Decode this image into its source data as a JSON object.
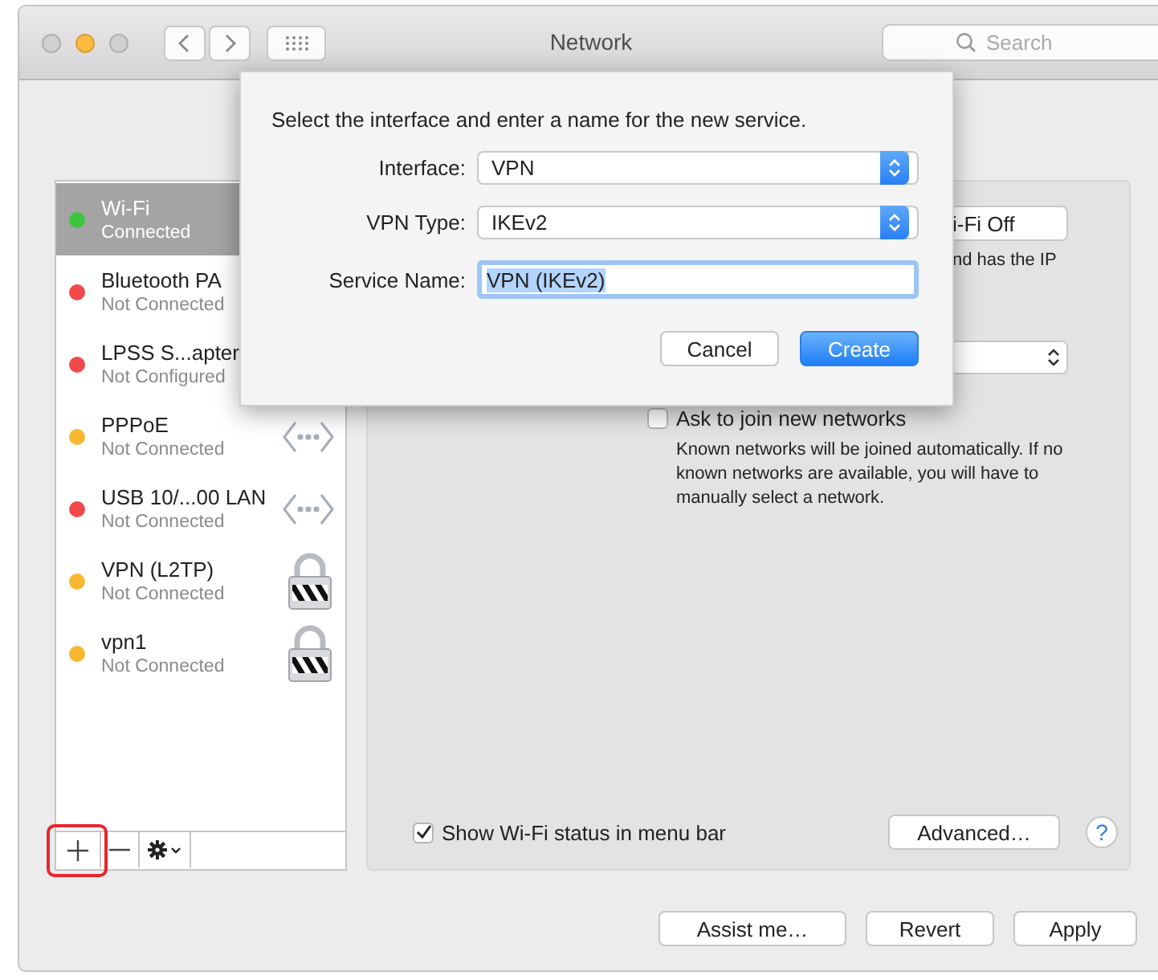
{
  "window": {
    "title": "Network",
    "lights": [
      {
        "kind": "close",
        "disabled": true
      },
      {
        "kind": "minimize",
        "disabled": false
      },
      {
        "kind": "zoom",
        "disabled": true
      }
    ]
  },
  "search": {
    "placeholder": "Search"
  },
  "services": [
    {
      "name": "Wi-Fi",
      "status": "Connected",
      "color": "#3ec43e",
      "selected": true,
      "kind": "plain"
    },
    {
      "name": "Bluetooth PA",
      "status": "Not Connected",
      "color": "#f04a4a",
      "selected": false,
      "kind": "plain"
    },
    {
      "name": "LPSS S...apter",
      "status": "Not Configured",
      "color": "#f04a4a",
      "selected": false,
      "kind": "plain"
    },
    {
      "name": "PPPoE",
      "status": "Not Connected",
      "color": "#f7b731",
      "selected": false,
      "kind": "ethernet"
    },
    {
      "name": "USB 10/...00 LAN",
      "status": "Not Connected",
      "color": "#f04a4a",
      "selected": false,
      "kind": "ethernet"
    },
    {
      "name": "VPN (L2TP)",
      "status": "Not Connected",
      "color": "#f7b731",
      "selected": false,
      "kind": "lock"
    },
    {
      "name": "vpn1",
      "status": "Not Connected",
      "color": "#f7b731",
      "selected": false,
      "kind": "lock"
    }
  ],
  "panel": {
    "wifi_button": "i-Fi Off",
    "status_text": "nd has the IP",
    "ask_to_join": {
      "label": "Ask to join new networks",
      "checked": false
    },
    "ask_note": "Known networks will be joined automatically. If no known networks are available, you will have to manually select a network.",
    "show_status": {
      "label": "Show Wi-Fi status in menu bar",
      "checked": true
    },
    "advanced_button": "Advanced…",
    "help_button": "?"
  },
  "dialog": {
    "prompt": "Select the interface and enter a name for the new service.",
    "fields": [
      {
        "kind": "popup",
        "label": "Interface:",
        "value": "VPN"
      },
      {
        "kind": "popup",
        "label": "VPN Type:",
        "value": "IKEv2"
      },
      {
        "kind": "text",
        "label": "Service Name:",
        "value": "VPN (IKEv2)"
      }
    ],
    "buttons": [
      {
        "label": "Cancel",
        "default": false
      },
      {
        "label": "Create",
        "default": true
      }
    ]
  },
  "footer_buttons": [
    "Assist me…",
    "Revert",
    "Apply"
  ]
}
